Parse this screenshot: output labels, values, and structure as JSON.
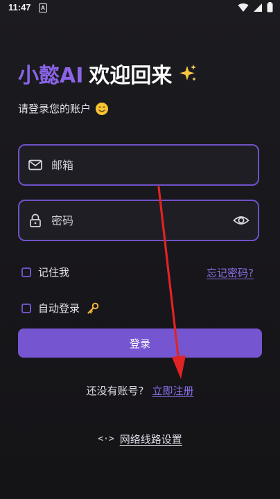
{
  "status_bar": {
    "time": "11:47",
    "notification_icon_letter": "A",
    "icons": [
      "wifi-icon",
      "signal-icon",
      "battery-icon"
    ]
  },
  "header": {
    "brand": "小懿AI",
    "welcome": "欢迎回来",
    "sparkle_icon": "sparkles-icon"
  },
  "subtitle": {
    "text": "请登录您的账户",
    "emoji_icon": "smiling-face-icon"
  },
  "form": {
    "email_placeholder": "邮箱",
    "email_value": "",
    "password_placeholder": "密码",
    "password_value": "",
    "remember_label": "记住我",
    "remember_checked": false,
    "autologin_label": "自动登录",
    "autologin_checked": false,
    "forgot_label": "忘记密码?",
    "login_button": "登录"
  },
  "register": {
    "prompt": "还没有账号?",
    "link": "立即注册"
  },
  "network": {
    "icon_text": "<·>",
    "label": "网络线路设置"
  },
  "colors": {
    "accent": "#7656d0",
    "brand_text": "#8b64e8",
    "link": "#8b6ee6",
    "annotation_arrow": "#e02424"
  }
}
